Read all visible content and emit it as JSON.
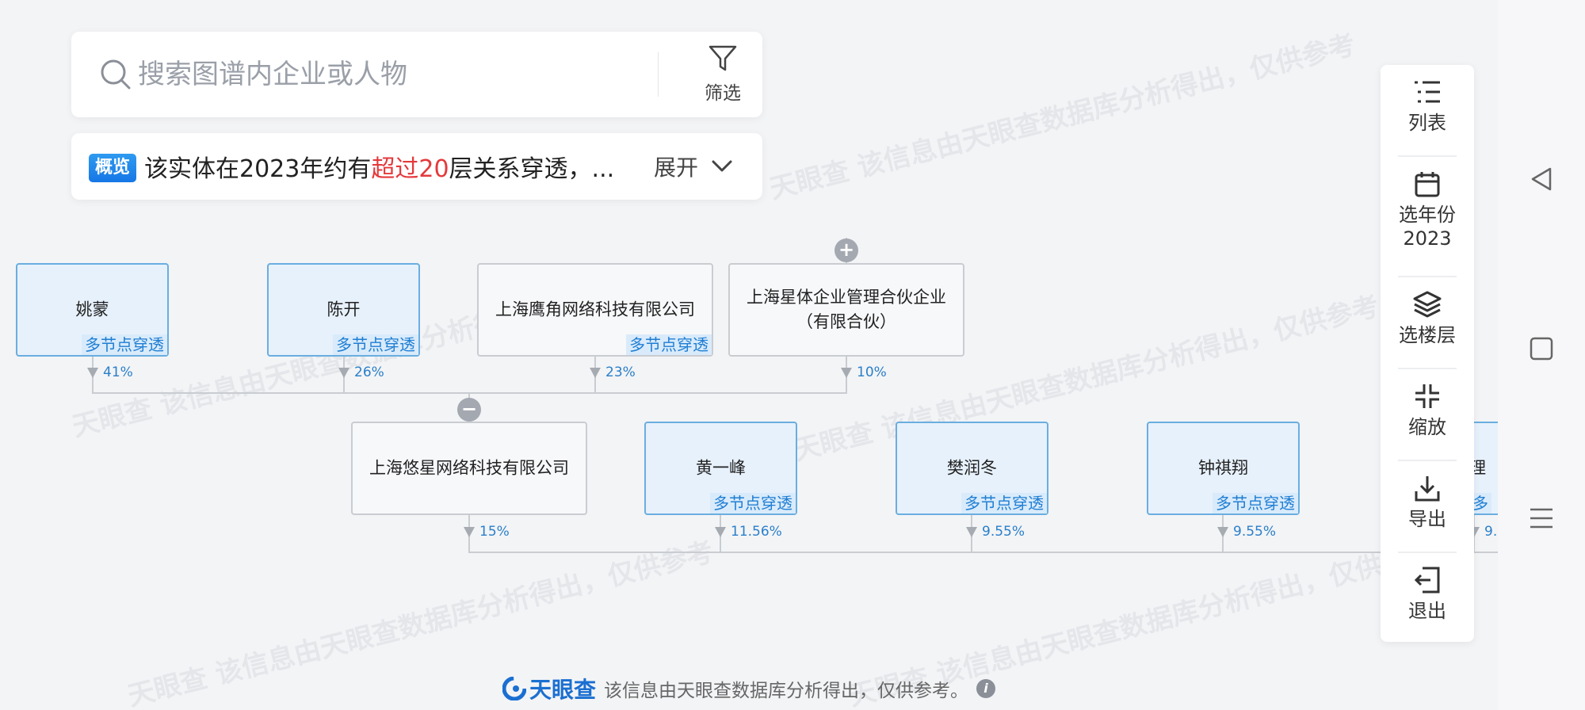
{
  "search": {
    "placeholder": "搜索图谱内企业或人物",
    "filter_label": "筛选"
  },
  "overview": {
    "badge": "概览",
    "text_before": "该实体在2023年约有",
    "text_highlight": "超过20",
    "text_after": "层关系穿透，...",
    "expand_label": "展开"
  },
  "shareholders": [
    {
      "name": "姚蒙",
      "type": "person",
      "tag": "多节点穿透",
      "percent": "41%"
    },
    {
      "name": "陈开",
      "type": "person",
      "tag": "多节点穿透",
      "percent": "26%"
    },
    {
      "name": "上海鹰角网络科技有限公司",
      "type": "company",
      "tag": "多节点穿透",
      "percent": "23%"
    },
    {
      "name": "上海星体企业管理合伙企业（有限合伙）",
      "type": "company",
      "tag": "",
      "percent": "10%"
    }
  ],
  "focus_company": {
    "name": "上海悠星网络科技有限公司",
    "percent": "15%"
  },
  "subsidiaries": [
    {
      "name": "黄一峰",
      "type": "person",
      "tag": "多节点穿透",
      "percent": "11.56%"
    },
    {
      "name": "樊润冬",
      "type": "person",
      "tag": "多节点穿透",
      "percent": "9.55%"
    },
    {
      "name": "钟祺翔",
      "type": "person",
      "tag": "多节点穿透",
      "percent": "9.55%"
    },
    {
      "name": "理",
      "type": "person",
      "tag": "多",
      "percent": "9."
    }
  ],
  "toolbar": {
    "list": "列表",
    "year": "选年份",
    "year_value": "2023",
    "floor": "选楼层",
    "zoom": "缩放",
    "export": "导出",
    "exit": "退出"
  },
  "watermark": "该信息由天眼查数据库分析得出，仅供参考",
  "footer": {
    "logo": "天眼查",
    "text": "该信息由天眼查数据库分析得出，仅供参考。",
    "info": "i"
  },
  "colors": {
    "accent": "#1677e6",
    "highlight": "#e4393c",
    "percent": "#2a7fc9",
    "person_bg": "#e7f1fc",
    "company_bg": "#f7f8fa"
  }
}
